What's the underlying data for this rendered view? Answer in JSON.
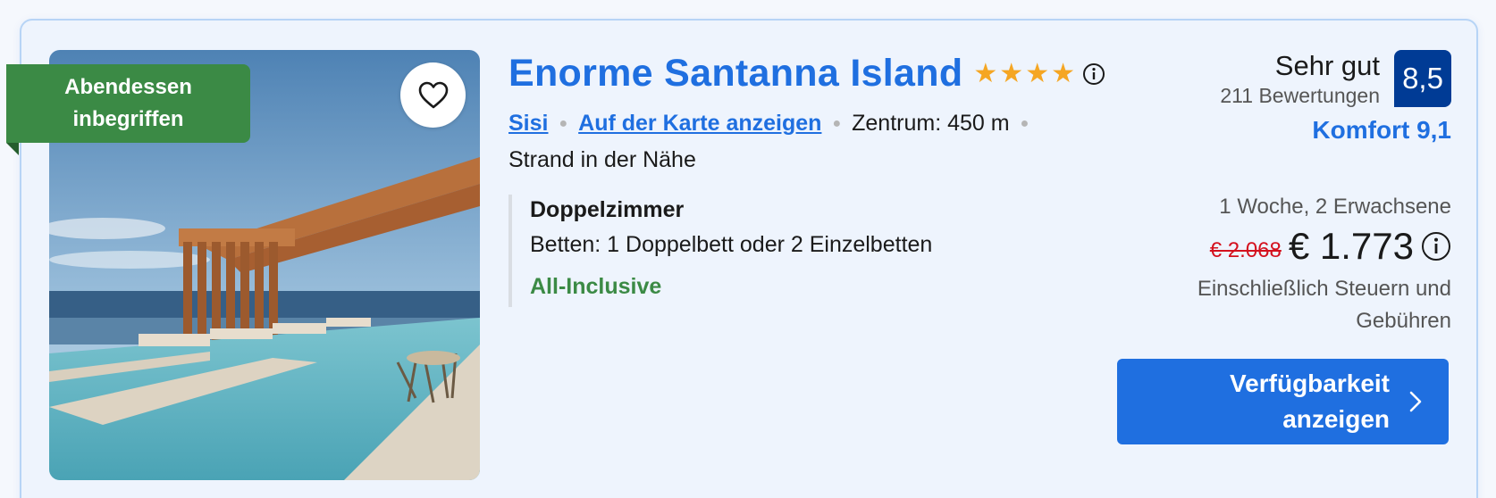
{
  "badge": {
    "line1": "Abendessen",
    "line2": "inbegriffen"
  },
  "hotel": {
    "name": "Enorme Santanna Island",
    "stars": 4
  },
  "location": {
    "area_link": "Sisi",
    "map_link": "Auf der Karte anzeigen",
    "distance": "Zentrum: 450 m",
    "beach": "Strand in der Nähe"
  },
  "room": {
    "type": "Doppelzimmer",
    "beds": "Betten: 1 Doppelbett oder 2 Einzelbetten",
    "board": "All-Inclusive"
  },
  "rating": {
    "label": "Sehr gut",
    "reviews": "211 Bewertungen",
    "score": "8,5",
    "komfort": "Komfort 9,1"
  },
  "pricing": {
    "stay": "1 Woche, 2 Erwachsene",
    "old_price": "€ 2.068",
    "new_price": "€ 1.773",
    "tax_line1": "Einschließlich Steuern und",
    "tax_line2": "Gebühren"
  },
  "cta": {
    "line1": "Verfügbarkeit",
    "line2": "anzeigen"
  },
  "colors": {
    "brand_blue": "#1f6fe0",
    "score_blue": "#003b95",
    "badge_green": "#3b8a45",
    "star_yellow": "#f5a623",
    "discount_red": "#d4111e"
  },
  "icons": {
    "favorite": "heart-icon",
    "info": "info-icon",
    "star": "star-icon",
    "cta": "chevron-right-icon"
  }
}
